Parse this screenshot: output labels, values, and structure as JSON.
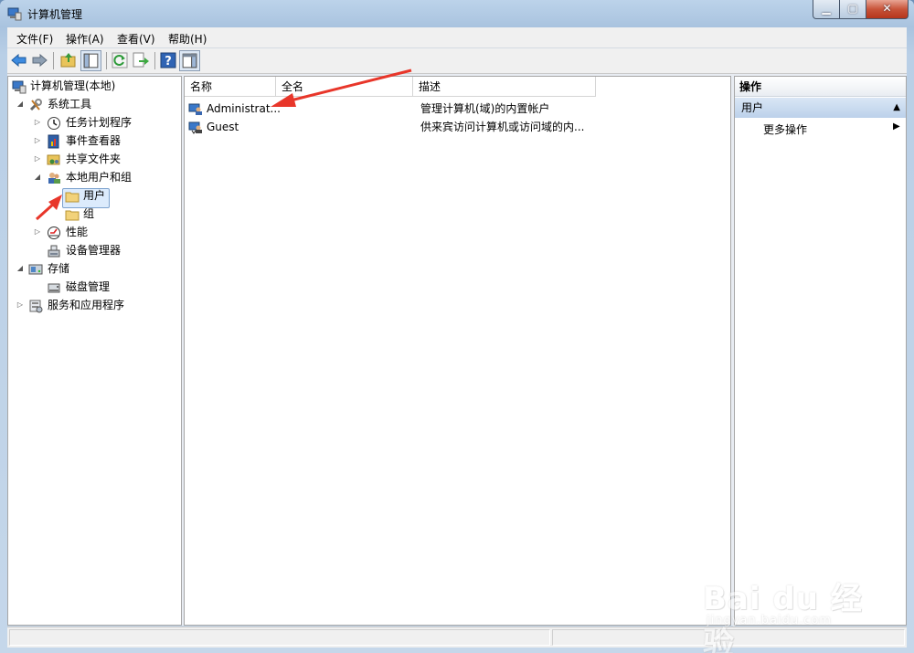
{
  "window": {
    "title": "计算机管理"
  },
  "caption": {
    "minimize": "▁",
    "maximize": "▢",
    "close": "✕"
  },
  "menu": [
    {
      "label": "文件(F)"
    },
    {
      "label": "操作(A)"
    },
    {
      "label": "查看(V)"
    },
    {
      "label": "帮助(H)"
    }
  ],
  "toolbar": {
    "icons": [
      "back-arrow-icon",
      "forward-arrow-icon",
      "up-folder-icon",
      "show-hide-tree-icon",
      "refresh-icon",
      "export-list-icon",
      "help-icon",
      "show-hide-action-pane-icon"
    ]
  },
  "tree": {
    "root": "计算机管理(本地)",
    "items": [
      {
        "label": "系统工具",
        "icon": "tools-icon",
        "expanded": true
      },
      {
        "label": "任务计划程序",
        "icon": "clock-icon",
        "expanded": false
      },
      {
        "label": "事件查看器",
        "icon": "event-viewer-icon",
        "expanded": false
      },
      {
        "label": "共享文件夹",
        "icon": "shared-folder-icon",
        "expanded": false
      },
      {
        "label": "本地用户和组",
        "icon": "users-group-icon",
        "expanded": true
      },
      {
        "label": "用户",
        "icon": "folder-icon",
        "selected": true
      },
      {
        "label": "组",
        "icon": "folder-icon"
      },
      {
        "label": "性能",
        "icon": "performance-icon",
        "expanded": false
      },
      {
        "label": "设备管理器",
        "icon": "device-manager-icon"
      },
      {
        "label": "存储",
        "icon": "storage-icon",
        "expanded": true
      },
      {
        "label": "磁盘管理",
        "icon": "disk-icon"
      },
      {
        "label": "服务和应用程序",
        "icon": "services-icon",
        "expanded": false
      }
    ]
  },
  "list": {
    "columns": [
      "名称",
      "全名",
      "描述"
    ],
    "rows": [
      {
        "name": "Administrat...",
        "fullname": "",
        "description": "管理计算机(域)的内置帐户"
      },
      {
        "name": "Guest",
        "fullname": "",
        "description": "供来宾访问计算机或访问域的内..."
      }
    ]
  },
  "actions": {
    "header": "操作",
    "section": "用户",
    "items": [
      {
        "label": "更多操作"
      }
    ]
  },
  "watermark": {
    "brand": "Bai du 经验",
    "url": "jingyan.baidu.com"
  },
  "colors": {
    "annotation_arrow": "#e8362a",
    "selection": "#dcebfc"
  }
}
